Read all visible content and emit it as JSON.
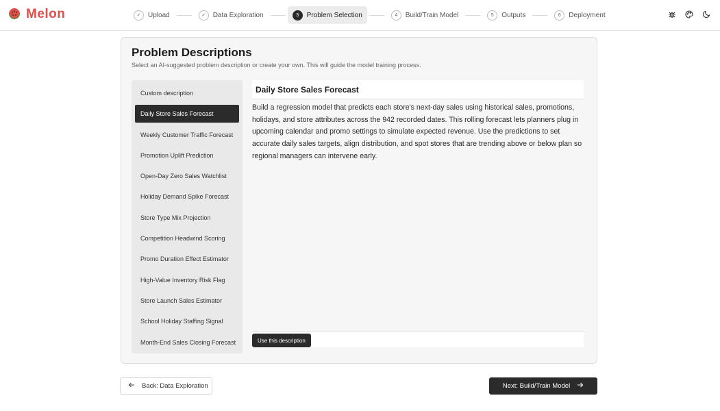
{
  "app": {
    "name": "Melon"
  },
  "stepper": {
    "steps": [
      {
        "num": "✓",
        "label": "Upload",
        "state": "done"
      },
      {
        "num": "✓",
        "label": "Data Exploration",
        "state": "done"
      },
      {
        "num": "3",
        "label": "Problem Selection",
        "state": "active"
      },
      {
        "num": "4",
        "label": "Build/Train Model",
        "state": "pending"
      },
      {
        "num": "5",
        "label": "Outputs",
        "state": "pending"
      },
      {
        "num": "6",
        "label": "Deployment",
        "state": "pending"
      }
    ]
  },
  "header_icons": [
    "bug-icon",
    "palette-icon",
    "moon-icon"
  ],
  "card": {
    "title": "Problem Descriptions",
    "subtitle": "Select an AI-suggested problem description or create your own. This will guide the model training process."
  },
  "problems": [
    "Custom description",
    "Daily Store Sales Forecast",
    "Weekly Customer Traffic Forecast",
    "Promotion Uplift Prediction",
    "Open-Day Zero Sales Watchlist",
    "Holiday Demand Spike Forecast",
    "Store Type Mix Projection",
    "Competition Headwind Scoring",
    "Promo Duration Effect Estimator",
    "High-Value Inventory Risk Flag",
    "Store Launch Sales Estimator",
    "School Holiday Staffing Signal",
    "Month-End Sales Closing Forecast"
  ],
  "selected_index": 1,
  "detail": {
    "title": "Daily Store Sales Forecast",
    "body": "Build a regression model that predicts each store's next-day sales using historical sales, promotions, holidays, and store attributes across the 942 recorded dates. This rolling forecast lets planners plug in upcoming calendar and promo settings to simulate expected revenue. Use the predictions to set accurate daily sales targets, align distribution, and spot stores that are trending above or below plan so regional managers can intervene early.",
    "use_button": "Use this description"
  },
  "nav": {
    "back": "Back: Data Exploration",
    "next": "Next: Build/Train Model"
  },
  "colors": {
    "brand": "#e0504a",
    "dark": "#2b2b2b"
  }
}
